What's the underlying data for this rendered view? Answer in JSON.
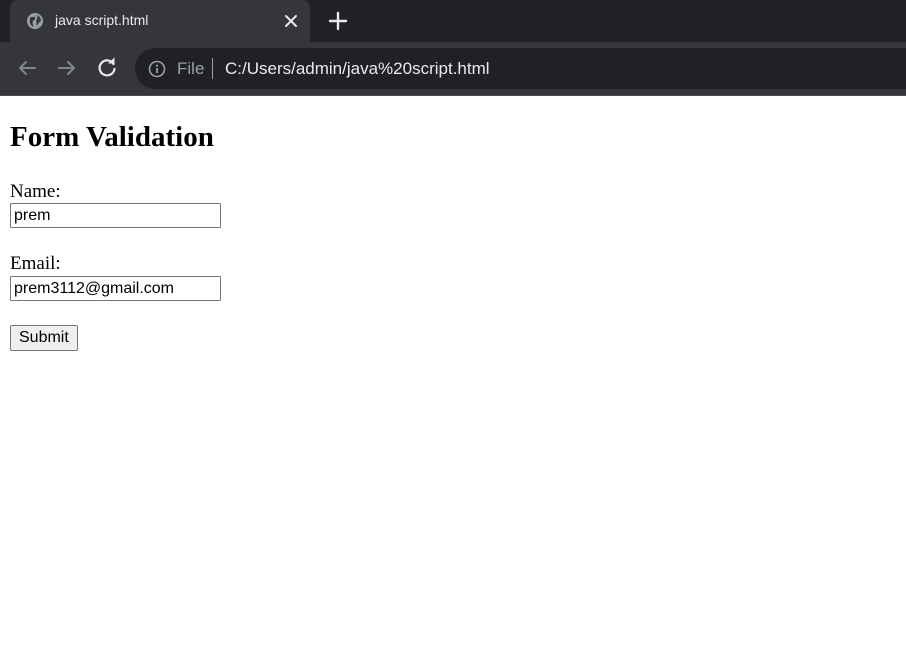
{
  "browser": {
    "tab_title": "java script.html",
    "address_scheme": "File",
    "address_url": "C:/Users/admin/java%20script.html"
  },
  "form": {
    "heading": "Form Validation",
    "name_label": "Name:",
    "name_value": "prem",
    "email_label": "Email:",
    "email_value": "prem3112@gmail.com",
    "submit_label": "Submit"
  },
  "colors": {
    "tabstrip_bg": "#202124",
    "toolbar_bg": "#35363a",
    "omnibox_bg": "#202124",
    "page_bg": "#ffffff"
  }
}
